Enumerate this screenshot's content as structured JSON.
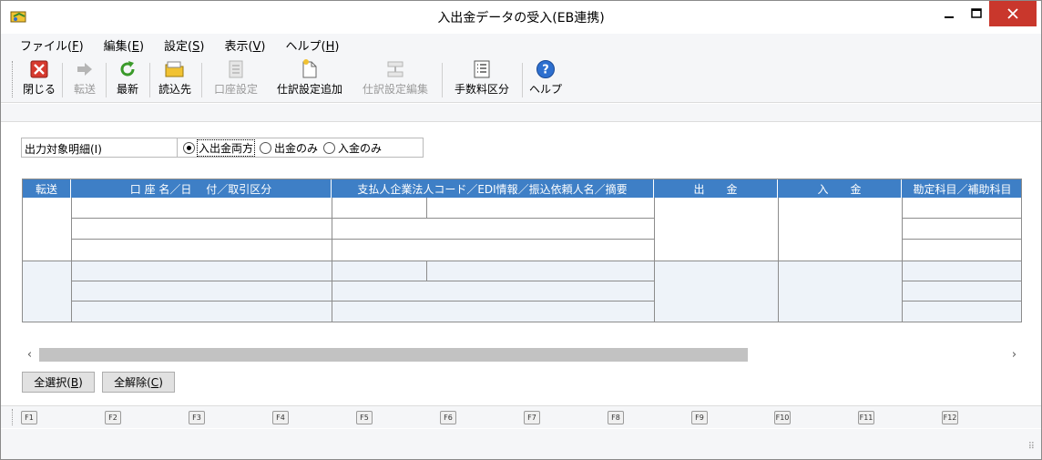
{
  "window": {
    "title": "入出金データの受入(EB連携)"
  },
  "menu": [
    {
      "label": "ファイル(",
      "key": "F",
      "suffix": ")"
    },
    {
      "label": "編集(",
      "key": "E",
      "suffix": ")"
    },
    {
      "label": "設定(",
      "key": "S",
      "suffix": ")"
    },
    {
      "label": "表示(",
      "key": "V",
      "suffix": ")"
    },
    {
      "label": "ヘルプ(",
      "key": "H",
      "suffix": ")"
    }
  ],
  "toolbar": {
    "close": "閉じる",
    "transfer": "転送",
    "refresh": "最新",
    "import_from": "読込先",
    "account_settings": "口座設定",
    "add_journal_settings": "仕訳設定追加",
    "edit_journal_settings": "仕訳設定編集",
    "fee_category": "手数料区分",
    "help": "ヘルプ"
  },
  "filter": {
    "label": "出力対象明細(I)",
    "options": [
      "入出金両方",
      "出金のみ",
      "入金のみ"
    ],
    "selected": "入出金両方"
  },
  "grid": {
    "columns": [
      "転送",
      "口 座 名／日　 付／取引区分",
      "支払人企業法人コード／EDI情報／振込依頼人名／摘要",
      "出　　金",
      "入　　金",
      "勘定科目／補助科目"
    ]
  },
  "buttons": {
    "select_all_prefix": "全選択(",
    "select_all_key": "B",
    "select_all_suffix": ")",
    "clear_all_prefix": "全解除(",
    "clear_all_key": "C",
    "clear_all_suffix": ")"
  },
  "function_keys": [
    "F1",
    "F2",
    "F3",
    "F4",
    "F5",
    "F6",
    "F7",
    "F8",
    "F9",
    "F10",
    "F11",
    "F12"
  ],
  "colors": {
    "grid_header": "#3e7fc6",
    "close_button": "#c9372c",
    "help_icon": "#2d6fcf"
  }
}
